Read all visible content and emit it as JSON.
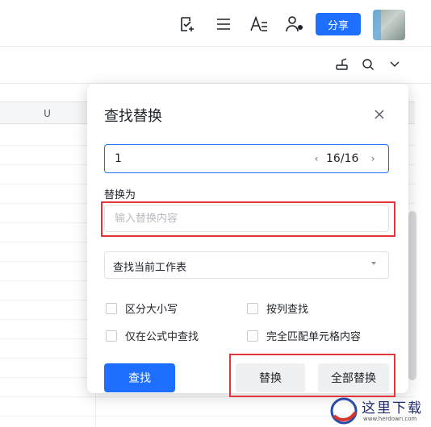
{
  "header": {
    "share_label": "分享",
    "icons": [
      "checklist-add-icon",
      "menu-lines-icon",
      "text-format-icon",
      "user-share-icon"
    ]
  },
  "toolbar2": {
    "icons": [
      "format-painter-icon",
      "search-icon",
      "chevron-down-icon"
    ]
  },
  "grid": {
    "column_header": "U"
  },
  "dialog": {
    "title": "查找替换",
    "find": {
      "value": "1",
      "count": "16/16",
      "prev_glyph": "‹",
      "next_glyph": "›"
    },
    "replace": {
      "label": "替换为",
      "placeholder": "输入替换内容"
    },
    "scope": {
      "selected": "查找当前工作表"
    },
    "options": {
      "match_case": "区分大小写",
      "by_column": "按列查找",
      "formula_only": "仅在公式中查找",
      "whole_cell": "完全匹配单元格内容"
    },
    "buttons": {
      "find": "查找",
      "replace": "替换",
      "replace_all": "全部替换"
    }
  },
  "watermark": {
    "text": "这里下载",
    "url": "www.herdown.com"
  },
  "colors": {
    "accent": "#1e6fff",
    "highlight_box": "#e2343a"
  }
}
